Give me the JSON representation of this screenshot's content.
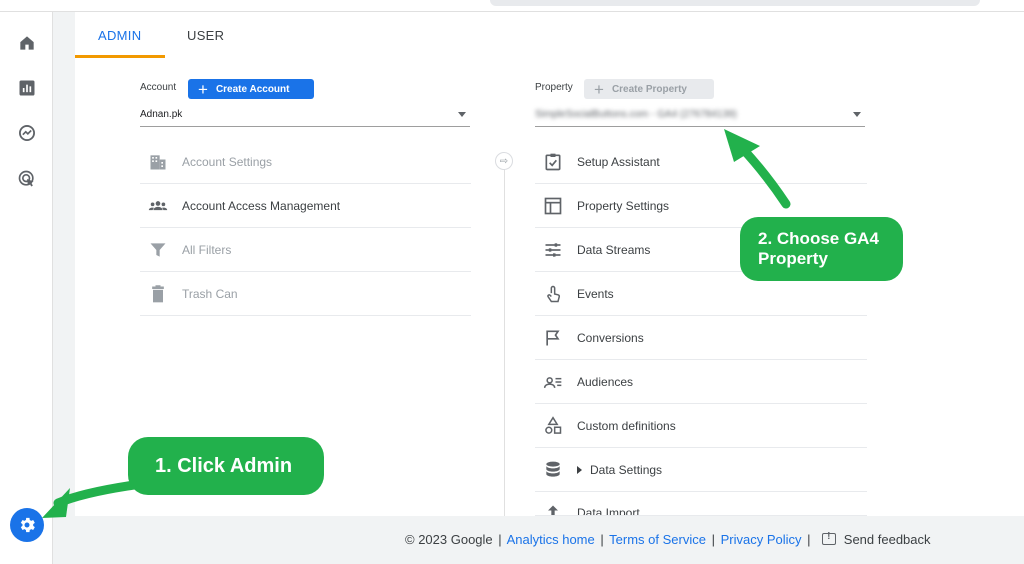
{
  "tabs": [
    {
      "label": "ADMIN",
      "active": true
    },
    {
      "label": "USER",
      "active": false
    }
  ],
  "account": {
    "label": "Account",
    "create_button": "Create Account",
    "selected": "Adnan.pk",
    "items": [
      {
        "label": "Account Settings",
        "icon": "building-icon",
        "dim": true
      },
      {
        "label": "Account Access Management",
        "icon": "people-icon",
        "dim": false
      },
      {
        "label": "All Filters",
        "icon": "filter-icon",
        "dim": true
      },
      {
        "label": "Trash Can",
        "icon": "trash-icon",
        "dim": true
      }
    ]
  },
  "property": {
    "label": "Property",
    "create_button": "Create Property",
    "selected": "SimpleSocialButtons.com - GA4 (276784139)",
    "items": [
      {
        "label": "Setup Assistant",
        "icon": "checklist-icon"
      },
      {
        "label": "Property Settings",
        "icon": "layout-icon"
      },
      {
        "label": "Data Streams",
        "icon": "streams-icon"
      },
      {
        "label": "Events",
        "icon": "touch-icon"
      },
      {
        "label": "Conversions",
        "icon": "flag-icon"
      },
      {
        "label": "Audiences",
        "icon": "audience-icon"
      },
      {
        "label": "Custom definitions",
        "icon": "shapes-icon"
      },
      {
        "label": "Data Settings",
        "icon": "database-icon",
        "expandable": true
      },
      {
        "label": "Data Import",
        "icon": "upload-icon"
      }
    ]
  },
  "footer": {
    "copyright": "© 2023 Google",
    "links": [
      "Analytics home",
      "Terms of Service",
      "Privacy Policy"
    ],
    "feedback": "Send feedback"
  },
  "annotations": {
    "step1": "1. Click Admin",
    "step2_line1": "2. Choose GA4",
    "step2_line2": "Property"
  },
  "colors": {
    "accent": "#1a73e8",
    "tab_underline": "#f29900",
    "callout": "#22b14c"
  }
}
